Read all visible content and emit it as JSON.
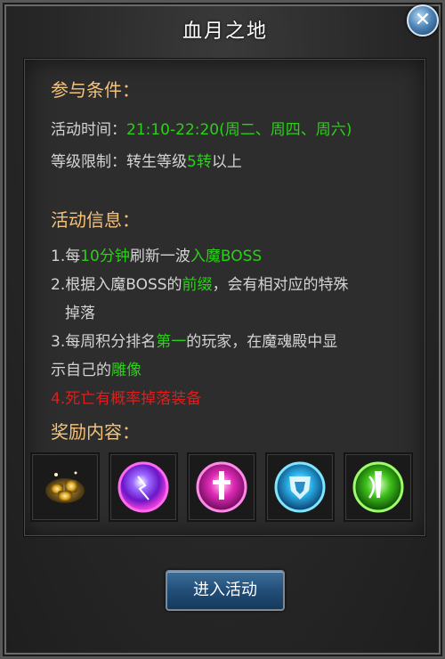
{
  "window": {
    "title": "血月之地",
    "close_icon": "close-icon"
  },
  "conditions": {
    "heading": "参与条件：",
    "time_label": "活动时间：",
    "time_value": "21:10-22:20(周二、周四、周六)",
    "level_label": "等级限制：",
    "level_prefix": "转生等级",
    "level_highlight": "5转",
    "level_suffix": "以上"
  },
  "info": {
    "heading": "活动信息：",
    "line1_a": "1.每",
    "line1_b": "10分钟",
    "line1_c": "刷新一波",
    "line1_d": "入魔BOSS",
    "line2_a": "2.根据入魔BOSS的",
    "line2_b": "前缀",
    "line2_c": "，会有相对应的特殊",
    "line2_d": "掉落",
    "line3_a": "3.每周积分排名",
    "line3_b": "第一",
    "line3_c": "的玩家，在魔魂殿中显",
    "line3_d": "示自己的",
    "line3_e": "雕像",
    "line4": "4.死亡有概率掉落装备"
  },
  "rewards": {
    "heading": "奖励内容：",
    "items": [
      {
        "icon": "gold-ingots-icon"
      },
      {
        "icon": "purple-orb-icon"
      },
      {
        "icon": "pink-sword-orb-icon"
      },
      {
        "icon": "blue-shield-orb-icon"
      },
      {
        "icon": "green-blade-orb-icon"
      }
    ]
  },
  "enter_button": {
    "label": "进入活动"
  },
  "colors": {
    "heading": "#f4c27a",
    "text": "#d4d4d4",
    "highlight_green": "#27d314",
    "highlight_red": "#e01d1d",
    "button_blue": "#214e78"
  }
}
